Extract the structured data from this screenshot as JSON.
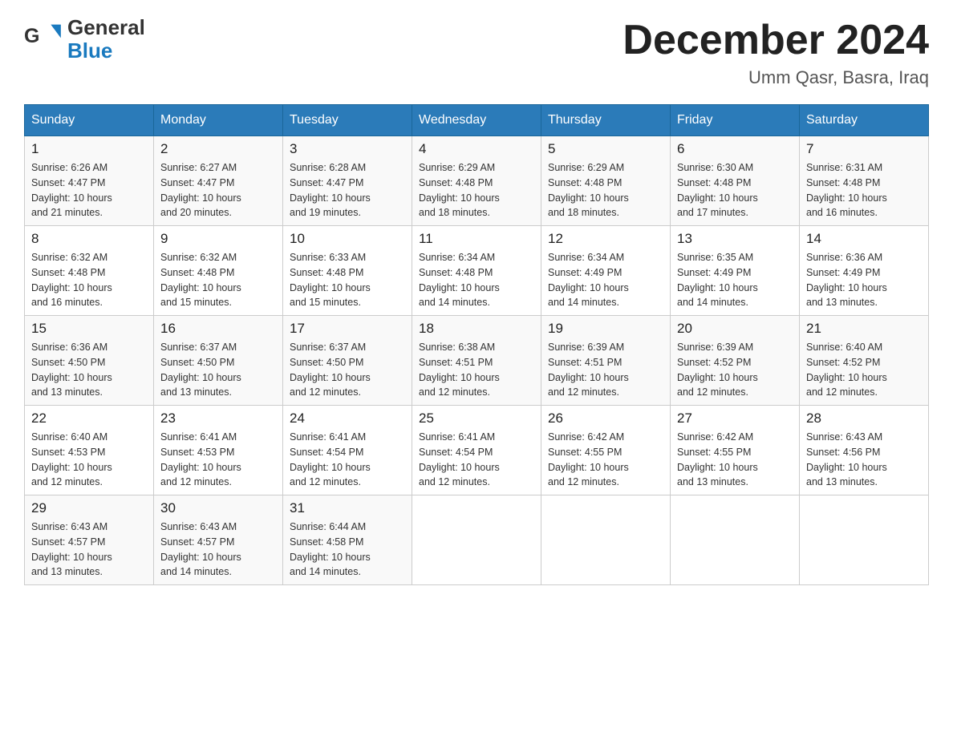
{
  "header": {
    "logo": {
      "text1": "General",
      "text2": "Blue"
    },
    "title": "December 2024",
    "subtitle": "Umm Qasr, Basra, Iraq"
  },
  "weekdays": [
    "Sunday",
    "Monday",
    "Tuesday",
    "Wednesday",
    "Thursday",
    "Friday",
    "Saturday"
  ],
  "weeks": [
    [
      {
        "day": "1",
        "sunrise": "6:26 AM",
        "sunset": "4:47 PM",
        "daylight": "10 hours and 21 minutes."
      },
      {
        "day": "2",
        "sunrise": "6:27 AM",
        "sunset": "4:47 PM",
        "daylight": "10 hours and 20 minutes."
      },
      {
        "day": "3",
        "sunrise": "6:28 AM",
        "sunset": "4:47 PM",
        "daylight": "10 hours and 19 minutes."
      },
      {
        "day": "4",
        "sunrise": "6:29 AM",
        "sunset": "4:48 PM",
        "daylight": "10 hours and 18 minutes."
      },
      {
        "day": "5",
        "sunrise": "6:29 AM",
        "sunset": "4:48 PM",
        "daylight": "10 hours and 18 minutes."
      },
      {
        "day": "6",
        "sunrise": "6:30 AM",
        "sunset": "4:48 PM",
        "daylight": "10 hours and 17 minutes."
      },
      {
        "day": "7",
        "sunrise": "6:31 AM",
        "sunset": "4:48 PM",
        "daylight": "10 hours and 16 minutes."
      }
    ],
    [
      {
        "day": "8",
        "sunrise": "6:32 AM",
        "sunset": "4:48 PM",
        "daylight": "10 hours and 16 minutes."
      },
      {
        "day": "9",
        "sunrise": "6:32 AM",
        "sunset": "4:48 PM",
        "daylight": "10 hours and 15 minutes."
      },
      {
        "day": "10",
        "sunrise": "6:33 AM",
        "sunset": "4:48 PM",
        "daylight": "10 hours and 15 minutes."
      },
      {
        "day": "11",
        "sunrise": "6:34 AM",
        "sunset": "4:48 PM",
        "daylight": "10 hours and 14 minutes."
      },
      {
        "day": "12",
        "sunrise": "6:34 AM",
        "sunset": "4:49 PM",
        "daylight": "10 hours and 14 minutes."
      },
      {
        "day": "13",
        "sunrise": "6:35 AM",
        "sunset": "4:49 PM",
        "daylight": "10 hours and 14 minutes."
      },
      {
        "day": "14",
        "sunrise": "6:36 AM",
        "sunset": "4:49 PM",
        "daylight": "10 hours and 13 minutes."
      }
    ],
    [
      {
        "day": "15",
        "sunrise": "6:36 AM",
        "sunset": "4:50 PM",
        "daylight": "10 hours and 13 minutes."
      },
      {
        "day": "16",
        "sunrise": "6:37 AM",
        "sunset": "4:50 PM",
        "daylight": "10 hours and 13 minutes."
      },
      {
        "day": "17",
        "sunrise": "6:37 AM",
        "sunset": "4:50 PM",
        "daylight": "10 hours and 12 minutes."
      },
      {
        "day": "18",
        "sunrise": "6:38 AM",
        "sunset": "4:51 PM",
        "daylight": "10 hours and 12 minutes."
      },
      {
        "day": "19",
        "sunrise": "6:39 AM",
        "sunset": "4:51 PM",
        "daylight": "10 hours and 12 minutes."
      },
      {
        "day": "20",
        "sunrise": "6:39 AM",
        "sunset": "4:52 PM",
        "daylight": "10 hours and 12 minutes."
      },
      {
        "day": "21",
        "sunrise": "6:40 AM",
        "sunset": "4:52 PM",
        "daylight": "10 hours and 12 minutes."
      }
    ],
    [
      {
        "day": "22",
        "sunrise": "6:40 AM",
        "sunset": "4:53 PM",
        "daylight": "10 hours and 12 minutes."
      },
      {
        "day": "23",
        "sunrise": "6:41 AM",
        "sunset": "4:53 PM",
        "daylight": "10 hours and 12 minutes."
      },
      {
        "day": "24",
        "sunrise": "6:41 AM",
        "sunset": "4:54 PM",
        "daylight": "10 hours and 12 minutes."
      },
      {
        "day": "25",
        "sunrise": "6:41 AM",
        "sunset": "4:54 PM",
        "daylight": "10 hours and 12 minutes."
      },
      {
        "day": "26",
        "sunrise": "6:42 AM",
        "sunset": "4:55 PM",
        "daylight": "10 hours and 12 minutes."
      },
      {
        "day": "27",
        "sunrise": "6:42 AM",
        "sunset": "4:55 PM",
        "daylight": "10 hours and 13 minutes."
      },
      {
        "day": "28",
        "sunrise": "6:43 AM",
        "sunset": "4:56 PM",
        "daylight": "10 hours and 13 minutes."
      }
    ],
    [
      {
        "day": "29",
        "sunrise": "6:43 AM",
        "sunset": "4:57 PM",
        "daylight": "10 hours and 13 minutes."
      },
      {
        "day": "30",
        "sunrise": "6:43 AM",
        "sunset": "4:57 PM",
        "daylight": "10 hours and 14 minutes."
      },
      {
        "day": "31",
        "sunrise": "6:44 AM",
        "sunset": "4:58 PM",
        "daylight": "10 hours and 14 minutes."
      },
      null,
      null,
      null,
      null
    ]
  ],
  "labels": {
    "sunrise": "Sunrise:",
    "sunset": "Sunset:",
    "daylight": "Daylight:"
  }
}
